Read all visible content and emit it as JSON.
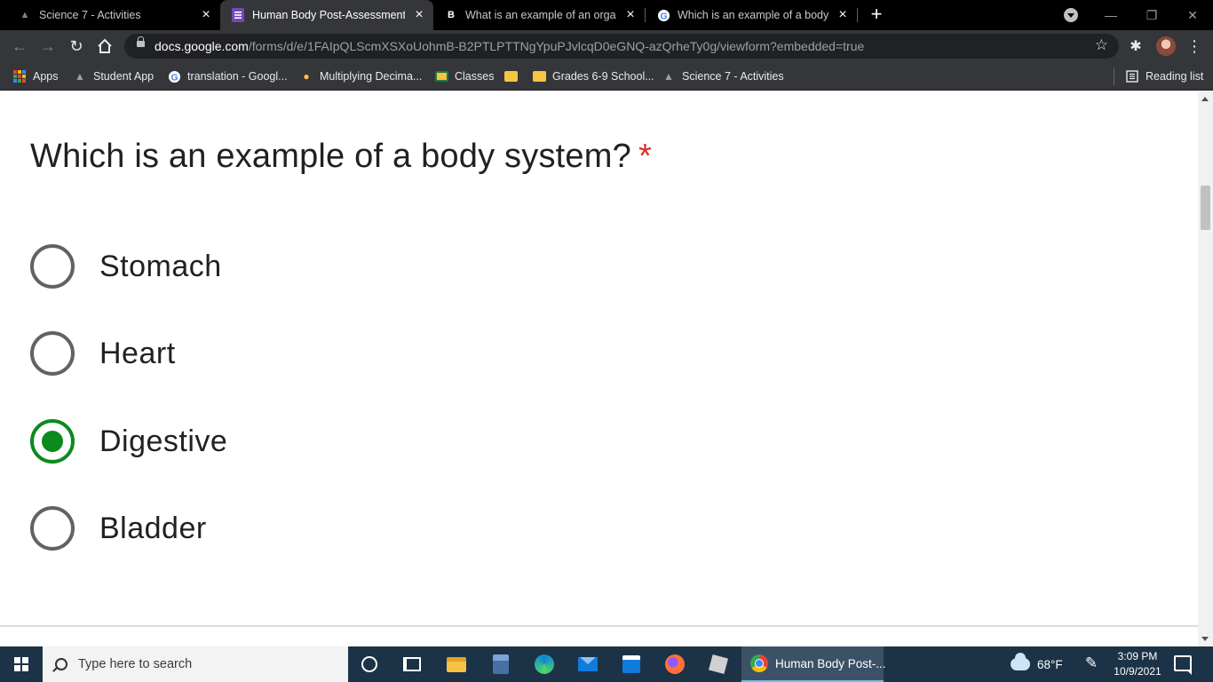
{
  "browser": {
    "tabs": [
      {
        "title": "Science 7 - Activities",
        "icon": "classroom-icon"
      },
      {
        "title": "Human Body Post-Assessment G",
        "icon": "google-forms-icon"
      },
      {
        "title": "What is an example of an organ?",
        "icon": "brainly-icon"
      },
      {
        "title": "Which is an example of a body sy",
        "icon": "google-icon"
      }
    ],
    "active_tab_index": 1,
    "url_host": "docs.google.com",
    "url_path": "/forms/d/e/1FAIpQLScmXSXoUohmB-B2PTLPTTNgYpuPJvlcqD0eGNQ-azQrheTy0g/viewform?embedded=true",
    "bookmarks": [
      {
        "label": "Apps",
        "icon": "apps-grid-icon"
      },
      {
        "label": "Student App",
        "icon": "classroom-icon"
      },
      {
        "label": "translation - Googl...",
        "icon": "google-icon"
      },
      {
        "label": "Multiplying Decima...",
        "icon": "lightbulb-icon"
      },
      {
        "label": "Classes",
        "icon": "classroom-icon"
      },
      {
        "label": "",
        "icon": "folder-icon"
      },
      {
        "label": "Grades 6-9 School...",
        "icon": "folder-icon"
      },
      {
        "label": "Science 7 - Activities",
        "icon": "classroom-icon"
      }
    ],
    "reading_list": "Reading list"
  },
  "form": {
    "question": "Which is an example of a body system?",
    "required_marker": "*",
    "options": [
      "Stomach",
      "Heart",
      "Digestive",
      "Bladder"
    ],
    "selected_index": 2,
    "accent_color": "#0b8a1d"
  },
  "taskbar": {
    "search_placeholder": "Type here to search",
    "active_app_title": "Human Body Post-...",
    "weather": "68°F",
    "time": "3:09 PM",
    "date": "10/9/2021"
  }
}
